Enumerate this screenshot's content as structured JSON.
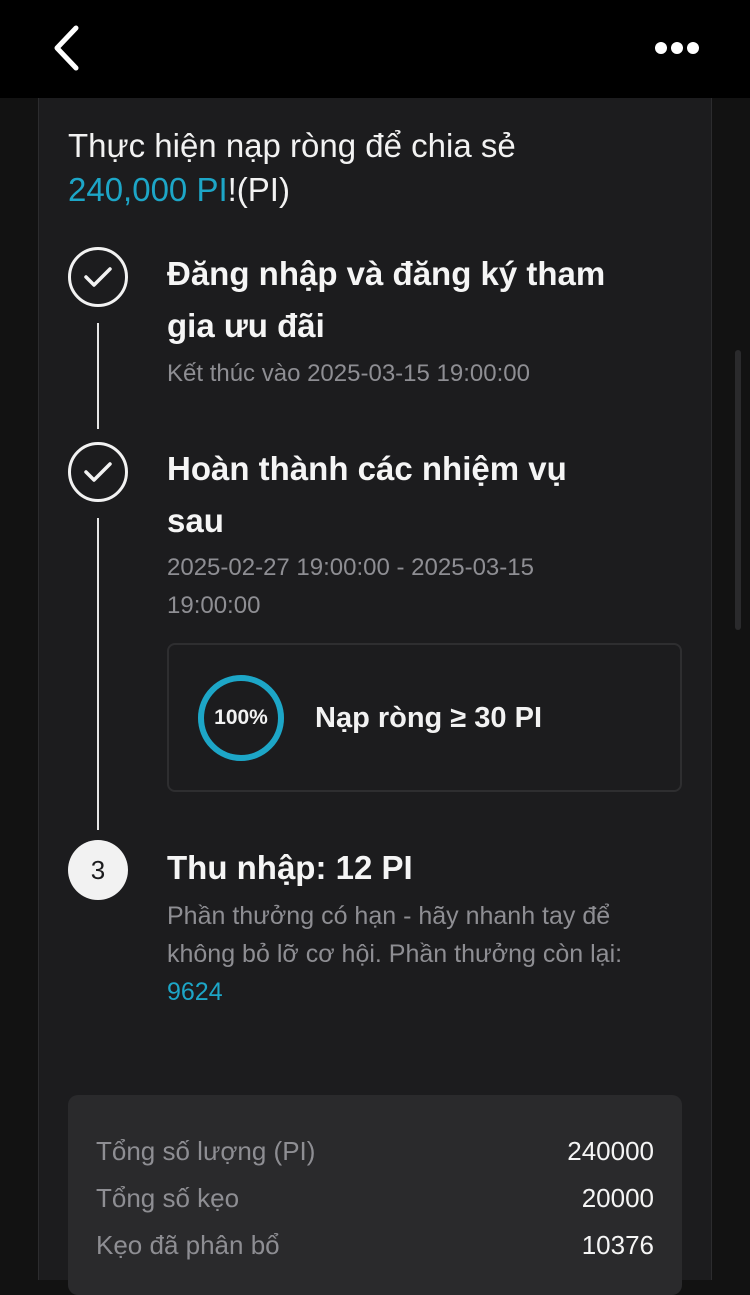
{
  "header": {
    "back_icon": "chevron-left-icon",
    "more_icon": "more-horizontal-icon"
  },
  "headline": {
    "prefix": "Thực hiện nạp ròng để chia sẻ",
    "amount": "240,000 PI",
    "suffix": "!(PI)"
  },
  "steps": [
    {
      "state": "done",
      "icon": "check-circle-icon",
      "title_line1": "Đăng nhập và đăng ký tham",
      "title_line2": "gia ưu đãi",
      "subtitle": "Kết thúc vào 2025-03-15 19:00:00"
    },
    {
      "state": "done",
      "icon": "check-circle-icon",
      "title_line1": "Hoàn thành các nhiệm vụ",
      "title_line2": "sau",
      "subtitle_line1": "2025-02-27 19:00:00 - 2025-03-15",
      "subtitle_line2": "19:00:00",
      "task": {
        "progress_percent": 100,
        "progress_label": "100%",
        "label": "Nạp ròng ≥ 30 PI"
      }
    },
    {
      "state": "pending",
      "number": "3",
      "title": "Thu nhập: 12 PI",
      "desc_line1": "Phần thưởng có hạn - hãy nhanh tay để",
      "desc_line2": "không bỏ lỡ cơ hội. Phần thưởng còn lại:",
      "remaining": "9624"
    }
  ],
  "stats": [
    {
      "label": "Tổng số lượng (PI)",
      "value": "240000"
    },
    {
      "label": "Tổng số kẹo",
      "value": "20000"
    },
    {
      "label": "Kẹo đã phân bổ",
      "value": "10376"
    }
  ],
  "colors": {
    "accent": "#1da6c7",
    "background": "#121212",
    "card": "#1c1c1e"
  }
}
